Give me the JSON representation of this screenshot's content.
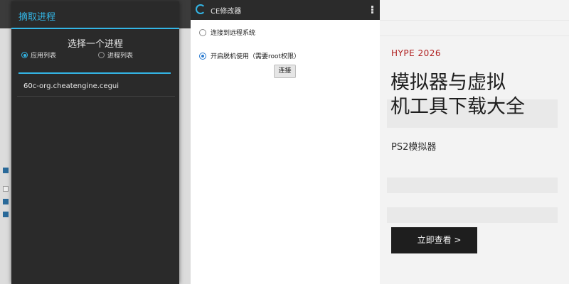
{
  "process_dialog": {
    "title": "摘取进程",
    "heading": "选择一个进程",
    "tabs": [
      {
        "label": "应用列表",
        "selected": true
      },
      {
        "label": "进程列表",
        "selected": false
      }
    ],
    "search_value": "",
    "processes": [
      "60c-org.cheatengine.cegui"
    ]
  },
  "ce_app": {
    "title": "CE修改器",
    "options": [
      {
        "label": "连接到远程系统",
        "selected": false
      },
      {
        "label": "开启脱机使用（需要root权限）",
        "selected": true
      }
    ],
    "connect_label": "连接"
  },
  "promo": {
    "tag": "HYPE 2026",
    "headline_line1": "模拟器与虚拟",
    "headline_line2": "机工具下载大全",
    "subline": "PS2模拟器",
    "cta_label": "立即查看 >"
  },
  "colors": {
    "accent": "#33b5e5",
    "tag": "#b02020",
    "cta_bg": "#1e1e1e"
  }
}
